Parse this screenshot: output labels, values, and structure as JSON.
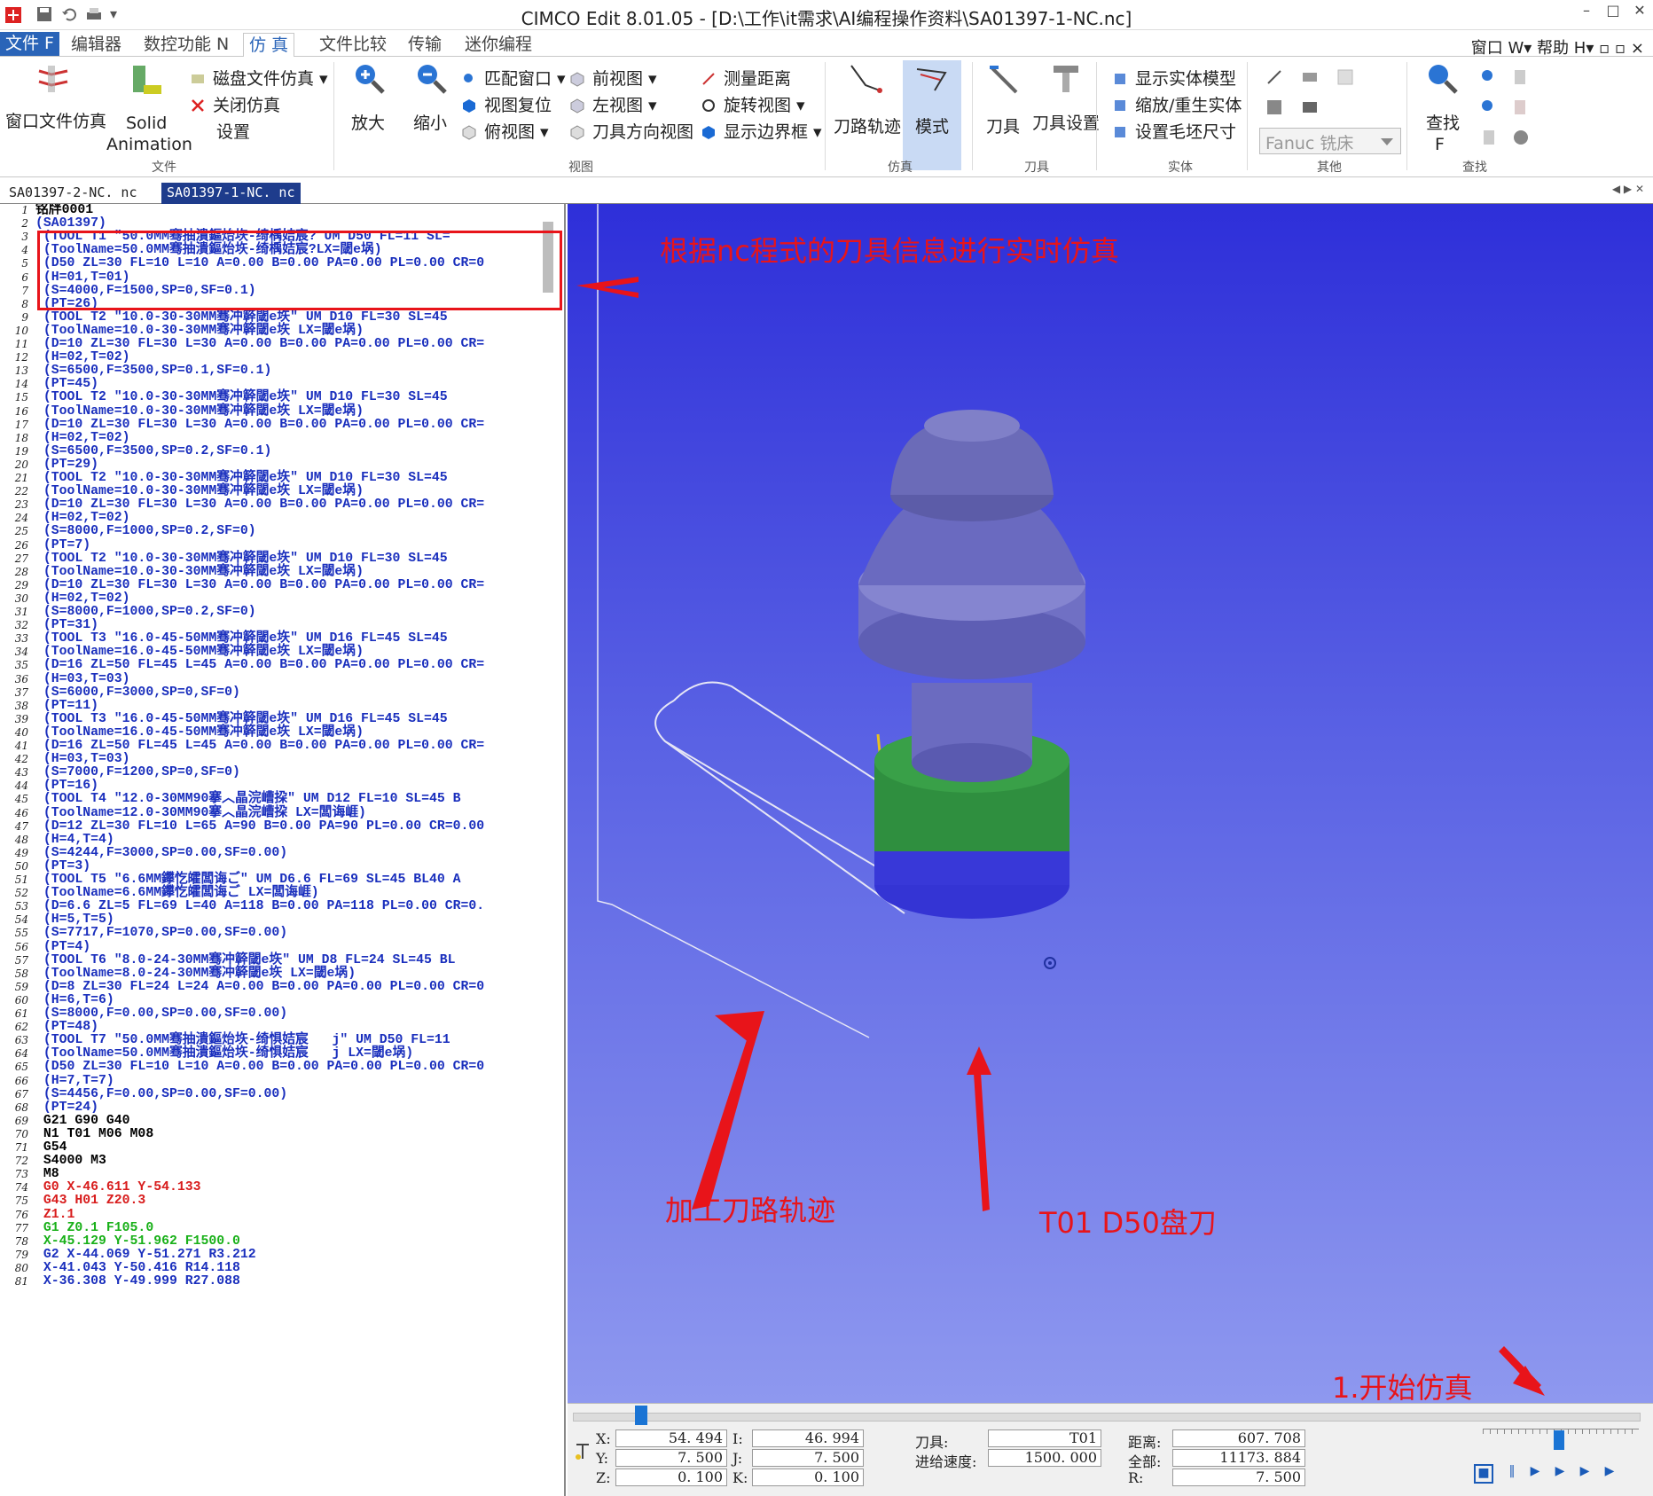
{
  "window": {
    "title": "CIMCO Edit 8.01.05 - [D:\\工作\\it需求\\AI编程操作资料\\SA01397-1-NC.nc]",
    "quick_access_dropdown": "▾",
    "controls": {
      "minimize": "–",
      "maximize": "□",
      "close": "✕"
    }
  },
  "menu": {
    "tabs": [
      "文件 F",
      "编辑器",
      "数控功能 N",
      "仿 真",
      "文件比较",
      "传输",
      "迷你编程"
    ],
    "right": "窗口 W▾ 帮助 H▾ ▫ ▫ ×"
  },
  "ribbon": {
    "file_group": {
      "window_sim": "窗口文件仿真",
      "solid_animation_1": "Solid",
      "solid_animation_2": "Animation",
      "disk_sim": "磁盘文件仿真",
      "close_sim": "关闭仿真",
      "settings": "设置",
      "label": "文件"
    },
    "view_group": {
      "zoom_in": "放大",
      "zoom_out": "缩小",
      "fit_window": "匹配窗口",
      "reset_view": "视图复位",
      "top_view": "俯视图",
      "front_view": "前视图",
      "left_view": "左视图",
      "tool_dir_view": "刀具方向视图",
      "measure": "测量距离",
      "rotate_view": "旋转视图",
      "show_bounds": "显示边界框",
      "label": "视图"
    },
    "sim_group": {
      "toolpath": "刀路轨迹",
      "mode": "模式",
      "label": "仿真"
    },
    "tool_group": {
      "tool": "刀具",
      "tool_settings": "刀具设置",
      "label": "刀具"
    },
    "solid_group": {
      "show_solid": "显示实体模型",
      "zoom_regen": "缩放/重生实体",
      "set_stock": "设置毛坯尺寸",
      "label": "实体"
    },
    "other_group": {
      "machine": "Fanuc 铣床",
      "label": "其他"
    },
    "find_group": {
      "find_1": "查找",
      "find_2": "F",
      "label": "查找"
    }
  },
  "doc_tabs": [
    {
      "name": "SA01397-2-NC. nc",
      "active": false
    },
    {
      "name": "SA01397-1-NC. nc",
      "active": true
    }
  ],
  "editor": {
    "lines": [
      {
        "n": "1",
        "t": "铭牉0001",
        "c": "#000000"
      },
      {
        "n": "2",
        "t": "(SA01397)",
        "c": "#1a2fbd"
      },
      {
        "n": "3",
        "t": " (TOOL T1 \"50.0MM骞抽潰鏂炲垁-绮楀姞宸? UM D50 FL=11 SL=",
        "c": "#1a2fbd"
      },
      {
        "n": "4",
        "t": " (ToolName=50.0MM骞抽潰鏂炲垁-绮楀姞宸?LX=閾e埚)",
        "c": "#1a2fbd"
      },
      {
        "n": "5",
        "t": " (D50 ZL=30 FL=10 L=10 A=0.00 B=0.00 PA=0.00 PL=0.00 CR=0",
        "c": "#1a2fbd"
      },
      {
        "n": "6",
        "t": " (H=01,T=01)",
        "c": "#1a2fbd"
      },
      {
        "n": "7",
        "t": " (S=4000,F=1500,SP=0,SF=0.1)",
        "c": "#1a2fbd"
      },
      {
        "n": "8",
        "t": " (PT=26)",
        "c": "#1a2fbd"
      },
      {
        "n": "9",
        "t": " (TOOL T2 \"10.0-30-30MM骞冲簳閾e垁\" UM D10 FL=30 SL=45 ",
        "c": "#1a2fbd"
      },
      {
        "n": "10",
        "t": " (ToolName=10.0-30-30MM骞冲簳閾e垁 LX=閾e埚)",
        "c": "#1a2fbd"
      },
      {
        "n": "11",
        "t": " (D=10 ZL=30 FL=30 L=30 A=0.00 B=0.00 PA=0.00 PL=0.00 CR=",
        "c": "#1a2fbd"
      },
      {
        "n": "12",
        "t": " (H=02,T=02)",
        "c": "#1a2fbd"
      },
      {
        "n": "13",
        "t": " (S=6500,F=3500,SP=0.1,SF=0.1)",
        "c": "#1a2fbd"
      },
      {
        "n": "14",
        "t": " (PT=45)",
        "c": "#1a2fbd"
      },
      {
        "n": "15",
        "t": " (TOOL T2 \"10.0-30-30MM骞冲簳閾e垁\" UM D10 FL=30 SL=45 ",
        "c": "#1a2fbd"
      },
      {
        "n": "16",
        "t": " (ToolName=10.0-30-30MM骞冲簳閾e垁 LX=閾e埚)",
        "c": "#1a2fbd"
      },
      {
        "n": "17",
        "t": " (D=10 ZL=30 FL=30 L=30 A=0.00 B=0.00 PA=0.00 PL=0.00 CR=",
        "c": "#1a2fbd"
      },
      {
        "n": "18",
        "t": " (H=02,T=02)",
        "c": "#1a2fbd"
      },
      {
        "n": "19",
        "t": " (S=6500,F=3500,SP=0.2,SF=0.1)",
        "c": "#1a2fbd"
      },
      {
        "n": "20",
        "t": " (PT=29)",
        "c": "#1a2fbd"
      },
      {
        "n": "21",
        "t": " (TOOL T2 \"10.0-30-30MM骞冲簳閾e垁\" UM D10 FL=30 SL=45 ",
        "c": "#1a2fbd"
      },
      {
        "n": "22",
        "t": " (ToolName=10.0-30-30MM骞冲簳閾e垁 LX=閾e埚)",
        "c": "#1a2fbd"
      },
      {
        "n": "23",
        "t": " (D=10 ZL=30 FL=30 L=30 A=0.00 B=0.00 PA=0.00 PL=0.00 CR=",
        "c": "#1a2fbd"
      },
      {
        "n": "24",
        "t": " (H=02,T=02)",
        "c": "#1a2fbd"
      },
      {
        "n": "25",
        "t": " (S=8000,F=1000,SP=0.2,SF=0)",
        "c": "#1a2fbd"
      },
      {
        "n": "26",
        "t": " (PT=7)",
        "c": "#1a2fbd"
      },
      {
        "n": "27",
        "t": " (TOOL T2 \"10.0-30-30MM骞冲簳閾e垁\" UM D10 FL=30 SL=45 ",
        "c": "#1a2fbd"
      },
      {
        "n": "28",
        "t": " (ToolName=10.0-30-30MM骞冲簳閾e垁 LX=閾e埚)",
        "c": "#1a2fbd"
      },
      {
        "n": "29",
        "t": " (D=10 ZL=30 FL=30 L=30 A=0.00 B=0.00 PA=0.00 PL=0.00 CR=",
        "c": "#1a2fbd"
      },
      {
        "n": "30",
        "t": " (H=02,T=02)",
        "c": "#1a2fbd"
      },
      {
        "n": "31",
        "t": " (S=8000,F=1000,SP=0.2,SF=0)",
        "c": "#1a2fbd"
      },
      {
        "n": "32",
        "t": " (PT=31)",
        "c": "#1a2fbd"
      },
      {
        "n": "33",
        "t": " (TOOL T3 \"16.0-45-50MM骞冲簳閾e垁\" UM D16 FL=45 SL=45 ",
        "c": "#1a2fbd"
      },
      {
        "n": "34",
        "t": " (ToolName=16.0-45-50MM骞冲簳閾e垁 LX=閾e埚)",
        "c": "#1a2fbd"
      },
      {
        "n": "35",
        "t": " (D=16 ZL=50 FL=45 L=45 A=0.00 B=0.00 PA=0.00 PL=0.00 CR=",
        "c": "#1a2fbd"
      },
      {
        "n": "36",
        "t": " (H=03,T=03)",
        "c": "#1a2fbd"
      },
      {
        "n": "37",
        "t": " (S=6000,F=3000,SP=0,SF=0)",
        "c": "#1a2fbd"
      },
      {
        "n": "38",
        "t": " (PT=11)",
        "c": "#1a2fbd"
      },
      {
        "n": "39",
        "t": " (TOOL T3 \"16.0-45-50MM骞冲簳閾e垁\" UM D16 FL=45 SL=45 ",
        "c": "#1a2fbd"
      },
      {
        "n": "40",
        "t": " (ToolName=16.0-45-50MM骞冲簳閾e垁 LX=閾e埚)",
        "c": "#1a2fbd"
      },
      {
        "n": "41",
        "t": " (D=16 ZL=50 FL=45 L=45 A=0.00 B=0.00 PA=0.00 PL=0.00 CR=",
        "c": "#1a2fbd"
      },
      {
        "n": "42",
        "t": " (H=03,T=03)",
        "c": "#1a2fbd"
      },
      {
        "n": "43",
        "t": " (S=7000,F=1200,SP=0,SF=0)",
        "c": "#1a2fbd"
      },
      {
        "n": "44",
        "t": " (PT=16)",
        "c": "#1a2fbd"
      },
      {
        "n": "45",
        "t": " (TOOL T4 \"12.0-30MM90搴︿晶浣嶆挅\" UM D12 FL=10 SL=45 B",
        "c": "#1a2fbd"
      },
      {
        "n": "46",
        "t": " (ToolName=12.0-30MM90搴︿晶浣嶆挅 LX=闆诲崕)",
        "c": "#1a2fbd"
      },
      {
        "n": "47",
        "t": " (D=12 ZL=30 FL=10 L=65 A=90 B=0.00 PA=90 PL=0.00 CR=0.00",
        "c": "#1a2fbd"
      },
      {
        "n": "48",
        "t": " (H=4,T=4)",
        "c": "#1a2fbd"
      },
      {
        "n": "49",
        "t": " (S=4244,F=3000,SP=0.00,SF=0.00)",
        "c": "#1a2fbd"
      },
      {
        "n": "50",
        "t": " (PT=3)",
        "c": "#1a2fbd"
      },
      {
        "n": "51",
        "t": " (TOOL T5 \"6.6MM鑻忔皬闆诲ご\" UM D6.6 FL=69 SL=45 BL40 A",
        "c": "#1a2fbd"
      },
      {
        "n": "52",
        "t": " (ToolName=6.6MM鑻忔皬闆诲ご LX=闆诲崕)",
        "c": "#1a2fbd"
      },
      {
        "n": "53",
        "t": " (D=6.6 ZL=5 FL=69 L=40 A=118 B=0.00 PA=118 PL=0.00 CR=0.",
        "c": "#1a2fbd"
      },
      {
        "n": "54",
        "t": " (H=5,T=5)",
        "c": "#1a2fbd"
      },
      {
        "n": "55",
        "t": " (S=7717,F=1070,SP=0.00,SF=0.00)",
        "c": "#1a2fbd"
      },
      {
        "n": "56",
        "t": " (PT=4)",
        "c": "#1a2fbd"
      },
      {
        "n": "57",
        "t": " (TOOL T6 \"8.0-24-30MM骞冲簳閾e垁\" UM D8 FL=24 SL=45 BL",
        "c": "#1a2fbd"
      },
      {
        "n": "58",
        "t": " (ToolName=8.0-24-30MM骞冲簳閾e垁 LX=閾e埚)",
        "c": "#1a2fbd"
      },
      {
        "n": "59",
        "t": " (D=8 ZL=30 FL=24 L=24 A=0.00 B=0.00 PA=0.00 PL=0.00 CR=0",
        "c": "#1a2fbd"
      },
      {
        "n": "60",
        "t": " (H=6,T=6)",
        "c": "#1a2fbd"
      },
      {
        "n": "61",
        "t": " (S=8000,F=0.00,SP=0.00,SF=0.00)",
        "c": "#1a2fbd"
      },
      {
        "n": "62",
        "t": " (PT=48)",
        "c": "#1a2fbd"
      },
      {
        "n": "63",
        "t": " (TOOL T7 \"50.0MM骞抽潰鏂炲垁-绮惧姞宸   j\" UM D50 FL=11",
        "c": "#1a2fbd"
      },
      {
        "n": "64",
        "t": " (ToolName=50.0MM骞抽潰鏂炲垁-绮惧姞宸   j LX=閾e埚)",
        "c": "#1a2fbd"
      },
      {
        "n": "65",
        "t": " (D50 ZL=30 FL=10 L=10 A=0.00 B=0.00 PA=0.00 PL=0.00 CR=0",
        "c": "#1a2fbd"
      },
      {
        "n": "66",
        "t": " (H=7,T=7)",
        "c": "#1a2fbd"
      },
      {
        "n": "67",
        "t": " (S=4456,F=0.00,SP=0.00,SF=0.00)",
        "c": "#1a2fbd"
      },
      {
        "n": "68",
        "t": " (PT=24)",
        "c": "#1a2fbd"
      },
      {
        "n": "69",
        "t": " G21 G90 G40",
        "c": "#000000"
      },
      {
        "n": "70",
        "t": " N1 T01 M06 M08",
        "c": "#000000"
      },
      {
        "n": "71",
        "t": " G54",
        "c": "#000000"
      },
      {
        "n": "72",
        "t": " S4000 M3",
        "c": "#000000"
      },
      {
        "n": "73",
        "t": " M8",
        "c": "#000000"
      },
      {
        "n": "74",
        "t": " G0 X-46.611 Y-54.133",
        "c": "#d81c1c"
      },
      {
        "n": "75",
        "t": " G43 H01 Z20.3",
        "c": "#d81c1c"
      },
      {
        "n": "76",
        "t": " Z1.1",
        "c": "#d81c1c"
      },
      {
        "n": "77",
        "t": " G1 Z0.1 F105.0",
        "c": "#18b018"
      },
      {
        "n": "78",
        "t": " X-45.129 Y-51.962 F1500.0",
        "c": "#18b018"
      },
      {
        "n": "79",
        "t": " G2 X-44.069 Y-51.271 R3.212",
        "c": "#1a2fbd"
      },
      {
        "n": "80",
        "t": " X-41.043 Y-50.416 R14.118",
        "c": "#1a2fbd"
      },
      {
        "n": "81",
        "t": " X-36.308 Y-49.999 R27.088",
        "c": "#1a2fbd"
      }
    ]
  },
  "annotations": {
    "tool_info": "根据nc程式的刀具信息进行实时仿真",
    "toolpath": "加工刀路轨迹",
    "tool_model": "T01 D50盘刀",
    "start_sim": "1.开始仿真"
  },
  "status": {
    "x_label": "X:",
    "x": "54. 494",
    "y_label": "Y:",
    "y": "7. 500",
    "z_label": "Z:",
    "z": "0. 100",
    "i_label": "I:",
    "i": "46. 994",
    "j_label": "J:",
    "j": "7. 500",
    "k_label": "K:",
    "k": "0. 100",
    "tool_label": "刀具:",
    "tool": "T01",
    "feed_label": "进给速度:",
    "feed": "1500. 000",
    "dist_label": "距离:",
    "dist": "607. 708",
    "total_label": "全部:",
    "total": "11173. 884",
    "r_label": "R:",
    "r": "7. 500"
  },
  "colors": {
    "accent": "#2a64b8",
    "annotation": "#e8141a",
    "highlight_box": "#e8141a",
    "tool_body": "#7575c8",
    "tool_green": "#2d8c3c",
    "tool_base": "#3a3ad8"
  }
}
